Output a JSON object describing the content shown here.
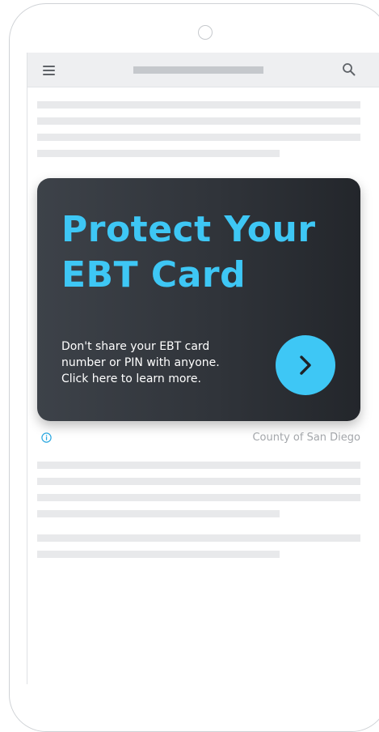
{
  "browser": {
    "menu_icon": "hamburger-menu-icon",
    "search_icon": "search-icon"
  },
  "ad": {
    "title_lines": [
      "Protect Your",
      "EBT Card"
    ],
    "body_lines": [
      "Don't share your EBT card",
      "number or PIN with anyone.",
      "Click here to learn more."
    ],
    "cta_icon": "chevron-right-icon",
    "info_icon": "info-icon",
    "advertiser": "County of San Diego",
    "colors": {
      "accent": "#3ec7f5",
      "card_background": "#33373d",
      "body_text": "#ffffff"
    }
  }
}
